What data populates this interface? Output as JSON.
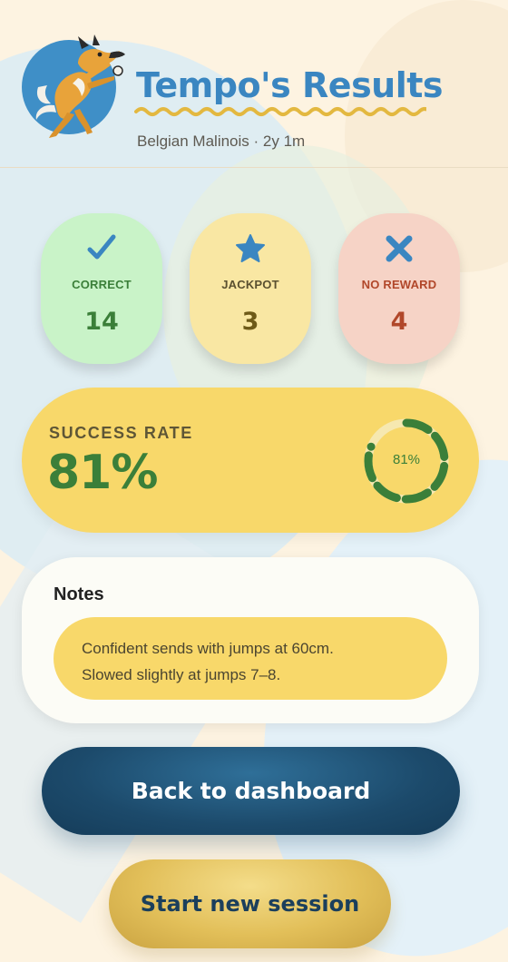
{
  "header": {
    "title": "Tempo's Results",
    "subtitle": "Belgian Malinois · 2y 1m",
    "avatar_icon": "dog-avatar-icon"
  },
  "stats": {
    "correct": {
      "label": "CORRECT",
      "value": "14",
      "icon": "checkmark-icon",
      "color": "#3b7f39"
    },
    "jackpot": {
      "label": "JACKPOT",
      "value": "3",
      "icon": "star-icon",
      "color": "#3a86c1"
    },
    "no_reward": {
      "label": "NO REWARD",
      "value": "4",
      "icon": "x-icon",
      "color": "#b1472a"
    }
  },
  "success": {
    "label": "SUCCESS RATE",
    "value": "81%",
    "ring_label": "81%",
    "rate": 0.81
  },
  "notes": {
    "heading": "Notes",
    "line1": "Confident sends with jumps at 60cm.",
    "line2": "Slowed slightly at jumps 7–8."
  },
  "actions": {
    "primary_label": "Back to dashboard",
    "secondary_label": "Start new session"
  },
  "colors": {
    "accent_blue": "#3a86c1",
    "success_green": "#3b7f39",
    "yellow": "#f8d86a",
    "navy": "#1c4a6b"
  }
}
